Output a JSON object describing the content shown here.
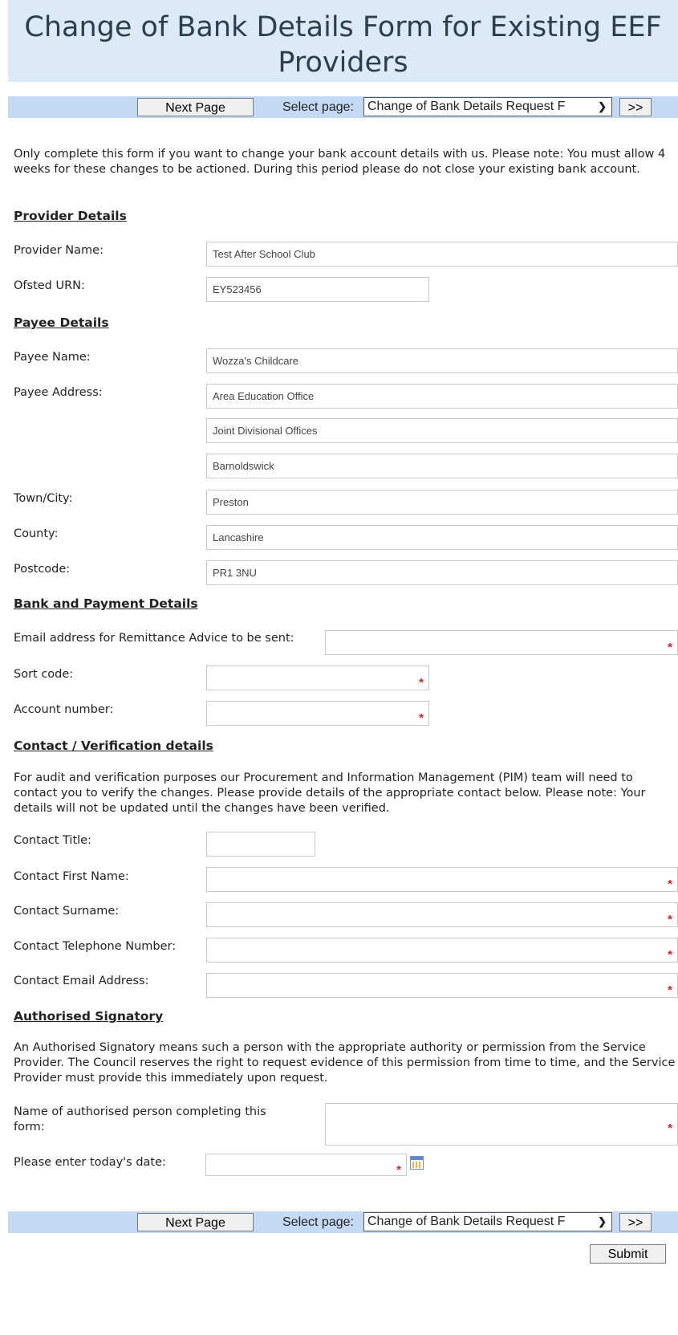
{
  "page_title": "Change of Bank Details Form for Existing EEF Providers",
  "nav": {
    "next_page_label": "Next Page",
    "select_page_label": "Select page:",
    "selected_page": "Change of Bank Details Request F",
    "forward_label": ">>"
  },
  "intro": "Only complete this form if you want to change your bank account details with us. Please note: You must allow 4 weeks for these changes to be actioned. During this period please do not close your existing bank account.",
  "provider": {
    "heading": "Provider Details",
    "name_label": "Provider Name:",
    "name_value": "Test After School Club",
    "urn_label": "Ofsted URN:",
    "urn_value": "EY523456"
  },
  "payee": {
    "heading": "Payee Details",
    "name_label": "Payee Name:",
    "name_value": "Wozza's Childcare",
    "address_label": "Payee Address:",
    "address_lines": [
      "Area Education Office",
      "Joint Divisional Offices",
      "Barnoldswick"
    ],
    "town_label": "Town/City:",
    "town_value": "Preston",
    "county_label": "County:",
    "county_value": "Lancashire",
    "postcode_label": "Postcode:",
    "postcode_value": "PR1 3NU"
  },
  "bank": {
    "heading": "Bank and Payment Details",
    "email_label": "Email address for Remittance Advice to be sent:",
    "sort_code_label": "Sort code:",
    "account_label": "Account number:"
  },
  "contact": {
    "heading": "Contact / Verification details",
    "intro": "For audit and verification purposes our Procurement and Information Management (PIM) team will need to contact you to verify the changes. Please provide details of the appropriate contact below. Please note: Your details will not be updated until the changes have been verified.",
    "title_label": "Contact Title:",
    "first_name_label": "Contact First Name:",
    "surname_label": "Contact Surname:",
    "phone_label": "Contact Telephone Number:",
    "email_label": "Contact Email Address:"
  },
  "signatory": {
    "heading": "Authorised Signatory",
    "intro": "An Authorised Signatory means such a person with the appropriate authority or permission from the Service Provider. The Council reserves the right to request evidence of this permission from time to time, and the Service Provider must provide this immediately upon request.",
    "name_label": "Name of authorised person completing this form:",
    "date_label": "Please enter today's date:"
  },
  "required_marker": "*",
  "submit_label": "Submit",
  "colors": {
    "title_band": "#dce9f7",
    "nav_band": "#c4d9f4",
    "required": "#e02020",
    "title_text": "#2c3e50"
  },
  "icons": {
    "date_picker": "calendar-icon"
  }
}
